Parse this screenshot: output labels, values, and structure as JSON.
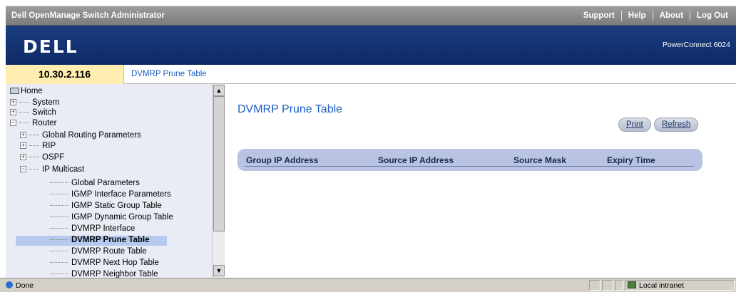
{
  "titlebar": {
    "title": "Dell OpenManage Switch Administrator",
    "links": [
      "Support",
      "Help",
      "About",
      "Log Out"
    ]
  },
  "brand": {
    "logo": "DELL",
    "product": "PowerConnect 6024"
  },
  "address": {
    "ip": "10.30.2.116",
    "breadcrumb": "DVMRP Prune Table"
  },
  "tree": {
    "home": "Home",
    "system": "System",
    "switch": "Switch",
    "router": "Router",
    "global_routing": "Global Routing Parameters",
    "rip": "RIP",
    "ospf": "OSPF",
    "ip_multicast": "IP Multicast",
    "leaves": [
      "Global Parameters",
      "IGMP Interface Parameters",
      "IGMP Static Group Table",
      "IGMP Dynamic Group Table",
      "DVMRP Interface",
      "DVMRP Prune Table",
      "DVMRP Route Table",
      "DVMRP Next Hop Table",
      "DVMRP Neighbor Table"
    ]
  },
  "main": {
    "title": "DVMRP Prune Table",
    "print_label": "Print",
    "refresh_label": "Refresh",
    "columns": [
      "Group IP Address",
      "Source IP Address",
      "Source Mask",
      "Expiry Time"
    ]
  },
  "status": {
    "left": "Done",
    "zone": "Local intranet"
  },
  "colors": {
    "brand_blue": "#1b3d7f",
    "link_blue": "#1b5ec2",
    "ip_highlight": "#ffeeb0",
    "table_header": "#b8c4e2"
  }
}
